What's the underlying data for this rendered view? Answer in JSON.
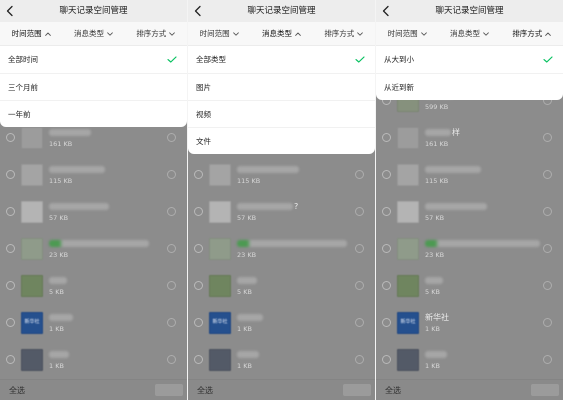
{
  "icons": {
    "back": "back-icon",
    "chevron_up": "chevron-up-icon",
    "chevron_down": "chevron-down-icon",
    "check": "check-icon",
    "radio": "radio-circle-icon",
    "more": "more-circle-icon"
  },
  "colors": {
    "accent": "#07c160",
    "dim_background": "#8c8c8c"
  },
  "panels": [
    {
      "title": "聊天记录空间管理",
      "filters": [
        {
          "label": "时间范围",
          "open": true
        },
        {
          "label": "消息类型",
          "open": false
        },
        {
          "label": "排序方式",
          "open": false
        }
      ],
      "dropdown": [
        {
          "label": "全部时间",
          "checked": true
        },
        {
          "label": "三个月前",
          "checked": false
        },
        {
          "label": "一年前",
          "checked": false
        }
      ],
      "items": [
        {
          "size": "161 KB",
          "thumb_color": "#9c9c9c"
        },
        {
          "size": "115 KB",
          "thumb_color": "#a4a4a4"
        },
        {
          "size": "57 KB",
          "thumb_color": "#b4b4b4"
        },
        {
          "size": "23 KB",
          "thumb_color": "#8f9b8a",
          "name_tint": "#4c9a52"
        },
        {
          "size": "5 KB",
          "thumb_color": "#6f855f"
        },
        {
          "size": "1 KB",
          "thumb_color": "#25508e",
          "logo": "新华社"
        },
        {
          "size": "1 KB",
          "thumb_color": "#535a67"
        }
      ],
      "footer": {
        "select_all": "全选"
      }
    },
    {
      "title": "聊天记录空间管理",
      "filters": [
        {
          "label": "时间范围",
          "open": false
        },
        {
          "label": "消息类型",
          "open": true
        },
        {
          "label": "排序方式",
          "open": false
        }
      ],
      "dropdown": [
        {
          "label": "全部类型",
          "checked": true
        },
        {
          "label": "图片",
          "checked": false
        },
        {
          "label": "视频",
          "checked": false
        },
        {
          "label": "文件",
          "checked": false
        }
      ],
      "items": [
        {
          "size": "115 KB",
          "thumb_color": "#a4a4a4"
        },
        {
          "size": "57 KB",
          "thumb_color": "#b4b4b4",
          "name_suffix": "?"
        },
        {
          "size": "23 KB",
          "thumb_color": "#8f9b8a",
          "name_tint": "#4c9a52"
        },
        {
          "size": "5 KB",
          "thumb_color": "#6f855f"
        },
        {
          "size": "1 KB",
          "thumb_color": "#25508e",
          "logo": "新华社"
        },
        {
          "size": "1 KB",
          "thumb_color": "#535a67"
        }
      ],
      "footer": {
        "select_all": "全选"
      }
    },
    {
      "title": "聊天记录空间管理",
      "filters": [
        {
          "label": "时间范围",
          "open": false
        },
        {
          "label": "消息类型",
          "open": false
        },
        {
          "label": "排序方式",
          "open": true
        }
      ],
      "dropdown": [
        {
          "label": "从大到小",
          "checked": true
        },
        {
          "label": "从近到新",
          "checked": false
        }
      ],
      "items": [
        {
          "size": "599 KB",
          "thumb_color": "#86917d"
        },
        {
          "size": "161 KB",
          "thumb_color": "#9c9c9c",
          "name_suffix": "样"
        },
        {
          "size": "115 KB",
          "thumb_color": "#a4a4a4"
        },
        {
          "size": "57 KB",
          "thumb_color": "#b4b4b4"
        },
        {
          "size": "23 KB",
          "thumb_color": "#8f9b8a",
          "name_tint": "#4c9a52"
        },
        {
          "size": "5 KB",
          "thumb_color": "#6f855f"
        },
        {
          "size": "1 KB",
          "thumb_color": "#25508e",
          "logo": "新华社",
          "name": "新华社"
        },
        {
          "size": "1 KB",
          "thumb_color": "#535a67"
        }
      ],
      "footer": {
        "select_all": "全选"
      }
    }
  ]
}
